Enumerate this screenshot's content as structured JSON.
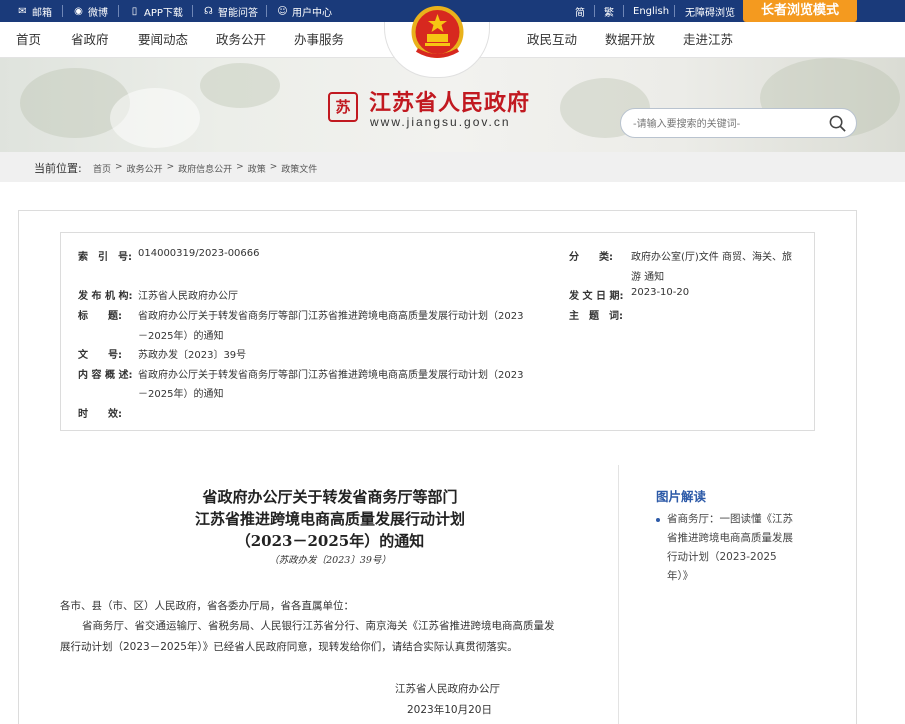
{
  "topbar": {
    "mail": "邮箱",
    "weibo": "微博",
    "app": "APP下载",
    "qa": "智能问答",
    "user": "用户中心",
    "simplified": "简",
    "traditional": "繁",
    "english": "English",
    "accessible": "无障碍浏览",
    "elder_mode": "长者浏览模式"
  },
  "nav": {
    "items": [
      "首页",
      "省政府",
      "要闻动态",
      "政务公开",
      "办事服务",
      "政民互动",
      "数据开放",
      "走进江苏"
    ]
  },
  "banner": {
    "seal_text": "苏",
    "title": "江苏省人民政府",
    "url": "www.jiangsu.gov.cn",
    "search_placeholder": "-请输入要搜索的关键词-"
  },
  "breadcrumb": {
    "label": "当前位置:",
    "items": [
      "首页",
      ">",
      "政务公开",
      ">",
      "政府信息公开",
      ">",
      "政策",
      ">",
      "政策文件"
    ]
  },
  "meta": {
    "index_key": "索　引　号:",
    "index_val": "014000319/2023-00666",
    "category_key": "分　　类:",
    "category_val_1": "政府办公室(厅)文件 商贸、海关、旅",
    "category_val_2": "游 通知",
    "issuer_key": "发 布 机 构:",
    "issuer_val": "江苏省人民政府办公厅",
    "date_key": "发 文 日 期:",
    "date_val": "2023-10-20",
    "title_key": "标　　题:",
    "title_val_1": "省政府办公厅关于转发省商务厅等部门江苏省推进跨境电商高质量发展行动计划（2023",
    "title_val_2": "－2025年）的通知",
    "subject_key": "主　题　词:",
    "docno_key": "文　　号:",
    "docno_val": "苏政办发〔2023〕39号",
    "content_key": "内 容 概 述:",
    "content_val_1": "省政府办公厅关于转发省商务厅等部门江苏省推进跨境电商高质量发展行动计划（2023",
    "content_val_2": "－2025年）的通知",
    "validity_key": "时　　效:"
  },
  "document": {
    "title_1": "省政府办公厅关于转发省商务厅等部门",
    "title_2": "江苏省推进跨境电商高质量发展行动计划",
    "title_3": "（2023－2025年）的通知",
    "docno": "（苏政办发〔2023〕39号）",
    "salutation": "各市、县（市、区）人民政府，省各委办厅局，省各直属单位：",
    "para_1": "省商务厅、省交通运输厅、省税务局、人民银行江苏省分行、南京海关《江苏省推进跨境电商高质量发",
    "para_2": "展行动计划（2023－2025年）》已经省人民政府同意，现转发给你们，请结合实际认真贯彻落实。",
    "signer": "江苏省人民政府办公厅",
    "sign_date": "2023年10月20日"
  },
  "sidebar": {
    "pic_title": "图片解读",
    "pic_item_1": "省商务厅：一图读懂《江苏",
    "pic_item_2": "省推进跨境电商高质量发展",
    "pic_item_3": "行动计划（2023-2025",
    "pic_item_4": "年）》"
  },
  "colors": {
    "topbar_bg": "#1a3a7a",
    "elder_btn": "#f49a1f",
    "brand_red": "#c11920",
    "link_blue": "#2d5aa8"
  }
}
